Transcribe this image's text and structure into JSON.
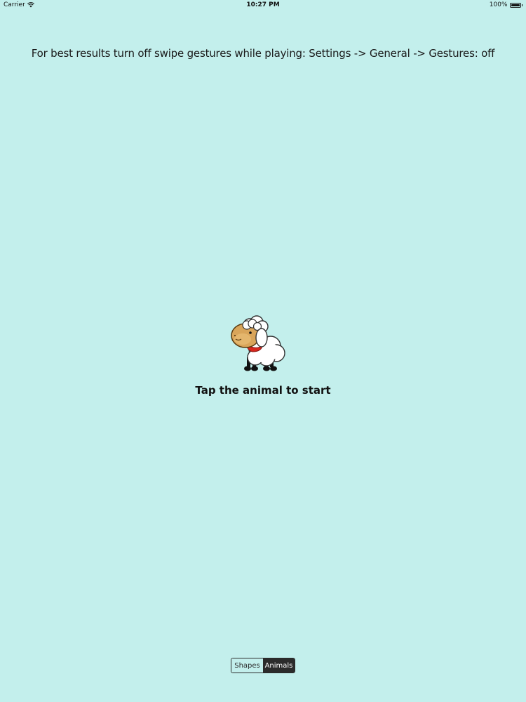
{
  "status_bar": {
    "carrier": "Carrier",
    "time": "10:27 PM",
    "battery": "100%",
    "battery_level": 1.0
  },
  "hint": {
    "text": "For best results turn off swipe gestures while playing: Settings -> General -> Gestures: off"
  },
  "start": {
    "caption": "Tap the animal to start",
    "animal_icon": "sheep-icon"
  },
  "mode_switch": {
    "options": [
      "Shapes",
      "Animals"
    ],
    "selected": "Animals"
  },
  "colors": {
    "background": "#c3efec",
    "segment_selected": "#2b2b2b"
  }
}
